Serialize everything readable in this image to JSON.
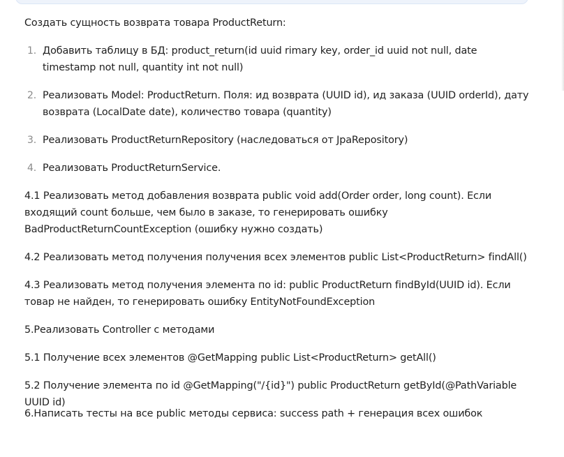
{
  "intro": "Создать сущность возврата товара ProductReturn:",
  "list": [
    {
      "num": "1.",
      "text": "Добавить таблицу в БД: product_return(id uuid rimary key, order_id uuid not null, date timestamp not null, quantity int not null)"
    },
    {
      "num": "2.",
      "text": "Реализовать Model: ProductReturn. Поля: ид возврата (UUID id), ид заказа (UUID orderId), дату возврата (LocalDate date), количество товара (quantity)"
    },
    {
      "num": "3.",
      "text": "Реализовать ProductReturnRepository (наследоваться от JpaRepository)"
    },
    {
      "num": "4.",
      "text": "Реализовать ProductReturnService."
    }
  ],
  "paragraphs": {
    "p41": "4.1 Реализовать метод добавления возврата public void add(Order order, long count). Если входящий count больше, чем было в заказе, то генерировать ошибку BadProductReturnCountException (ошибку нужно создать)",
    "p42": "4.2 Реализовать метод получения получения всех элементов public List<ProductReturn> findAll()",
    "p43": "4.3 Реализовать метод получения элемента по id: public ProductReturn findById(UUID id). Если товар не найден, то генерировать ошибку EntityNotFoundException",
    "p5": "5.Реализовать Controller с методами",
    "p51": "5.1 Получение всех элементов @GetMapping public List<ProductReturn> getAll()",
    "p52": "5.2 Получение элемента по id @GetMapping(\"/{id}\") public ProductReturn getById(@PathVariable UUID id)",
    "p6": "6.Написать тесты на все public методы сервиса: success path + генерация всех ошибок"
  }
}
